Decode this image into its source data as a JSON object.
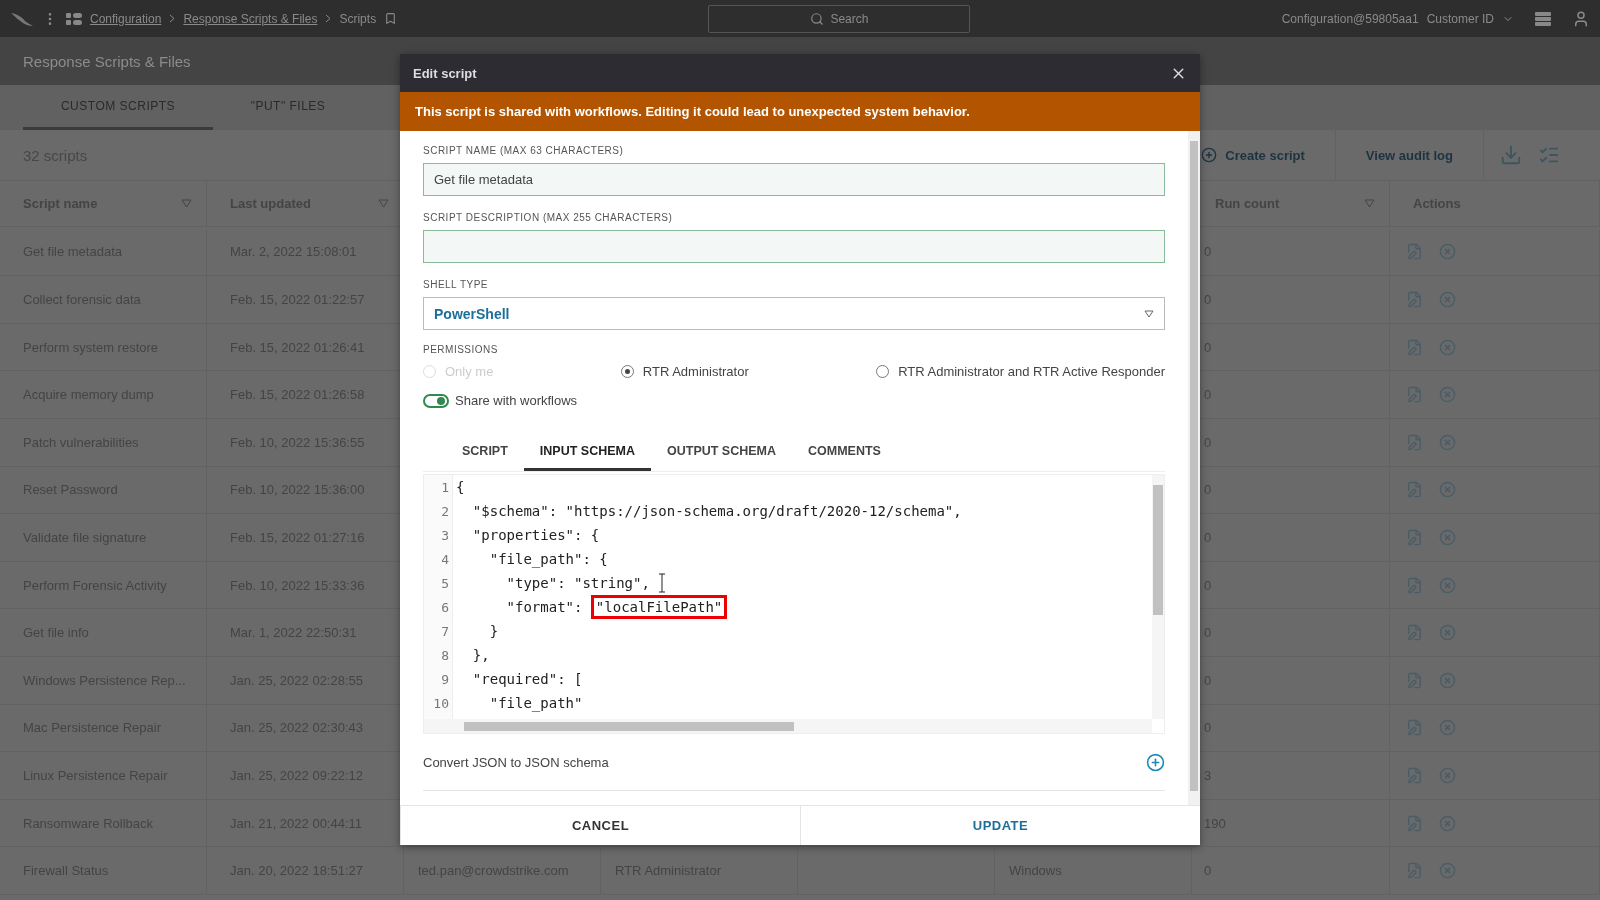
{
  "top_bar": {
    "breadcrumbs": [
      {
        "label": "Configuration",
        "link": true
      },
      {
        "label": "Response Scripts & Files",
        "link": true
      },
      {
        "label": "Scripts",
        "link": false
      }
    ],
    "search": {
      "placeholder": "Search"
    },
    "account": "Configuration@59805aa1",
    "customer": "Customer ID"
  },
  "page_title": "Response Scripts & Files",
  "tabs": [
    {
      "label": "CUSTOM SCRIPTS",
      "selected": true
    },
    {
      "label": "\"PUT\" FILES",
      "selected": false
    }
  ],
  "count": "32 scripts",
  "actions": [
    {
      "label": "Create script",
      "kind": "create"
    },
    {
      "label": "View audit log",
      "kind": "plain"
    }
  ],
  "table": {
    "columns": [
      {
        "label": "Script name",
        "filter": true
      },
      {
        "label": "Last updated",
        "filter": true
      },
      {
        "label": "Run count",
        "filter": true
      },
      {
        "label": "Actions",
        "filter": false
      }
    ],
    "rows": [
      {
        "name": "Get file metadata",
        "updated": "Mar. 2, 2022 15:08:01",
        "run_count": "0"
      },
      {
        "name": "Collect forensic data",
        "updated": "Feb. 15, 2022 01:22:57",
        "run_count": "0"
      },
      {
        "name": "Perform system restore",
        "updated": "Feb. 15, 2022 01:26:41",
        "run_count": "0"
      },
      {
        "name": "Acquire memory dump",
        "updated": "Feb. 15, 2022 01:26:58",
        "run_count": "0"
      },
      {
        "name": "Patch vulnerabilities",
        "updated": "Feb. 10, 2022 15:36:55",
        "run_count": "0"
      },
      {
        "name": "Reset Password",
        "updated": "Feb. 10, 2022 15:36:00",
        "run_count": "0"
      },
      {
        "name": "Validate file signature",
        "updated": "Feb. 15, 2022 01:27:16",
        "run_count": "0"
      },
      {
        "name": "Perform Forensic Activity",
        "updated": "Feb. 10, 2022 15:33:36",
        "run_count": "0"
      },
      {
        "name": "Get file info",
        "updated": "Mar. 1, 2022 22:50:31",
        "run_count": "0"
      },
      {
        "name": "Windows Persistence Rep...",
        "updated": "Jan. 25, 2022 02:28:55",
        "run_count": "0"
      },
      {
        "name": "Mac Persistence Repair",
        "updated": "Jan. 25, 2022 02:30:43",
        "run_count": "0"
      },
      {
        "name": "Linux Persistence Repair",
        "updated": "Jan. 25, 2022 09:22:12",
        "run_count": "3"
      },
      {
        "name": "Ransomware Rollback",
        "updated": "Jan. 21, 2022 00:44:11",
        "run_count": "190"
      },
      {
        "name": "Firewall Status",
        "updated": "Jan. 20, 2022 18:51:27",
        "run_count": "0",
        "author": "ted.pan@crowdstrike.com",
        "permission": "RTR Administrator",
        "os": "Windows"
      }
    ]
  },
  "modal": {
    "title": "Edit script",
    "warning": "This script is shared with workflows. Editing it could lead to unexpected system behavior.",
    "name_label": "SCRIPT NAME (MAX 63 CHARACTERS)",
    "name_value": "Get file metadata",
    "description_label": "SCRIPT DESCRIPTION (MAX 255 CHARACTERS)",
    "shell_label": "SHELL TYPE",
    "shell_value": "PowerShell",
    "permissions": {
      "label": "PERMISSIONS",
      "options": [
        {
          "label": "Only me",
          "selected": false,
          "disabled": true
        },
        {
          "label": "RTR Administrator",
          "selected": true,
          "disabled": false
        },
        {
          "label": "RTR Administrator and RTR Active Responder",
          "selected": false,
          "disabled": false
        }
      ]
    },
    "share": {
      "label": "Share with workflows",
      "on": true
    },
    "tabs": [
      {
        "label": "SCRIPT",
        "selected": false
      },
      {
        "label": "INPUT SCHEMA",
        "selected": true
      },
      {
        "label": "OUTPUT SCHEMA",
        "selected": false
      },
      {
        "label": "COMMENTS",
        "selected": false
      }
    ],
    "code": [
      {
        "number": "1",
        "text": "{"
      },
      {
        "number": "2",
        "text": "  \"$schema\": \"https://json-schema.org/draft/2020-12/schema\","
      },
      {
        "number": "3",
        "text": "  \"properties\": {"
      },
      {
        "number": "4",
        "text": "    \"file_path\": {"
      },
      {
        "number": "5",
        "text": "      \"type\": \"string\",",
        "cursor": true
      },
      {
        "number": "6",
        "text": "      \"format\": ",
        "highlight": "\"localFilePath\""
      },
      {
        "number": "7",
        "text": "    }"
      },
      {
        "number": "8",
        "text": "  },"
      },
      {
        "number": "9",
        "text": "  \"required\": ["
      },
      {
        "number": "10",
        "text": "    \"file_path\""
      }
    ],
    "convert": "Convert JSON to JSON schema",
    "buttons": [
      {
        "label": "CANCEL",
        "primary": false
      },
      {
        "label": "UPDATE",
        "primary": true
      }
    ]
  }
}
